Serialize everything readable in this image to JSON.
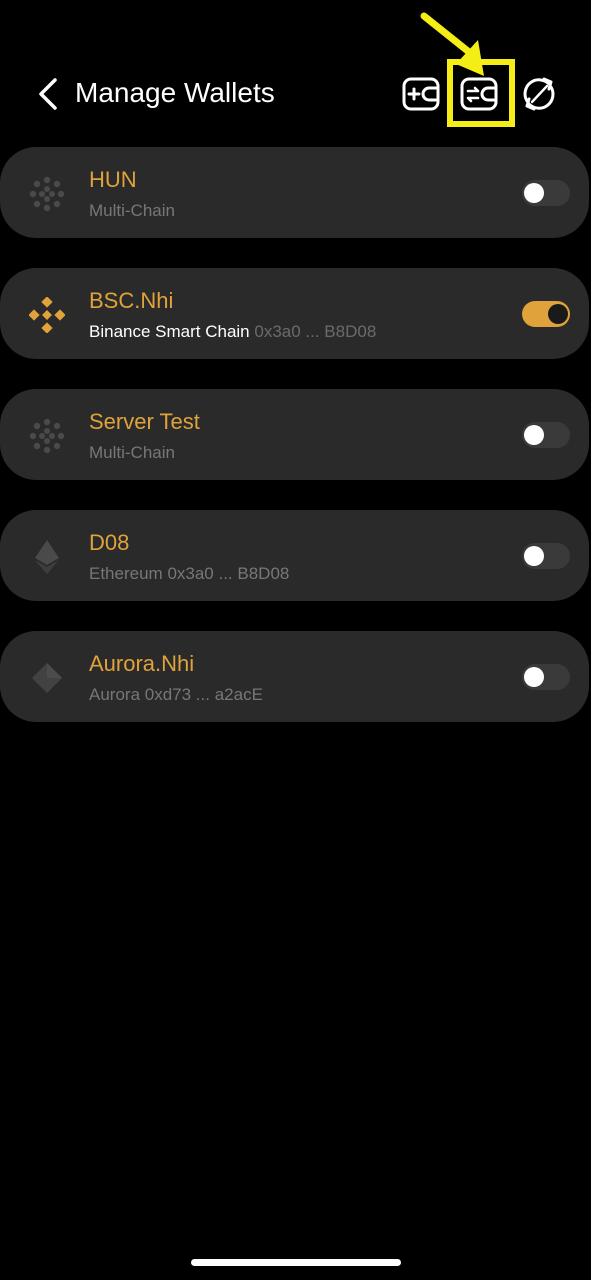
{
  "header": {
    "title": "Manage Wallets",
    "back_icon": "chevron-left-icon",
    "actions": [
      {
        "name": "add-wallet",
        "icon": "wallet-plus-icon"
      },
      {
        "name": "swap-wallet",
        "icon": "wallet-swap-icon",
        "highlighted": true
      },
      {
        "name": "sync",
        "icon": "sync-icon"
      }
    ]
  },
  "colors": {
    "accent": "#e0a23a",
    "card_bg": "#2a2a2a",
    "highlight": "#f4ee16"
  },
  "wallets": [
    {
      "name": "HUN",
      "chain": "Multi-Chain",
      "address": "",
      "icon": "multi-chain-icon",
      "enabled": false
    },
    {
      "name": "BSC.Nhi",
      "chain": "Binance Smart Chain",
      "address": "0x3a0 ... B8D08",
      "icon": "binance-icon",
      "enabled": true
    },
    {
      "name": "Server Test",
      "chain": "Multi-Chain",
      "address": "",
      "icon": "multi-chain-icon",
      "enabled": false
    },
    {
      "name": "D08",
      "chain": "Ethereum",
      "address": "0x3a0 ... B8D08",
      "icon": "ethereum-icon",
      "enabled": false
    },
    {
      "name": "Aurora.Nhi",
      "chain": "Aurora",
      "address": "0xd73 ... a2acE",
      "icon": "aurora-icon",
      "enabled": false
    }
  ]
}
